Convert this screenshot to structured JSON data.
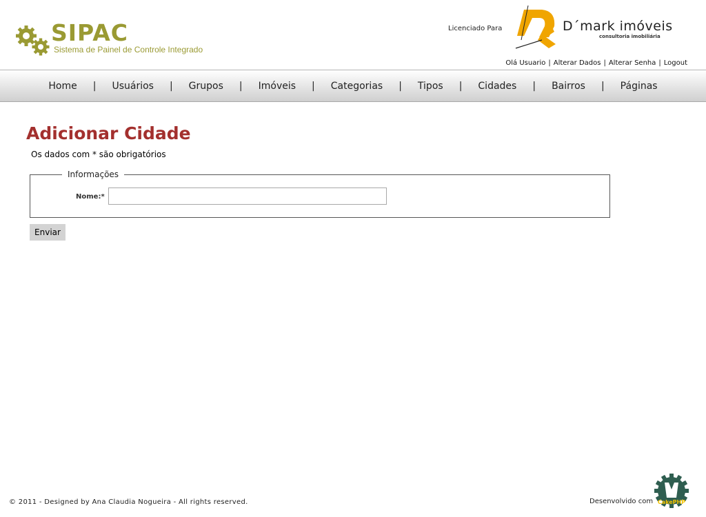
{
  "header": {
    "logo_title": "SIPAC",
    "logo_subtitle": "Sistema de Painel de Controle Integrado",
    "licensed_label": "Licenciado Para",
    "client_name": "D´mark imóveis",
    "client_tagline": "consultoria imobiliária",
    "user_links": {
      "greeting": "Olá Usuario",
      "edit_data": "Alterar Dados",
      "change_password": "Alterar Senha",
      "logout": "Logout",
      "separator": "|"
    }
  },
  "nav": {
    "items": [
      "Home",
      "Usuários",
      "Grupos",
      "Imóveis",
      "Categorias",
      "Tipos",
      "Cidades",
      "Bairros",
      "Páginas"
    ],
    "separator": "|"
  },
  "main": {
    "title": "Adicionar Cidade",
    "required_note": "Os dados com * são obrigatórios",
    "fieldset_legend": "Informações",
    "name_label": "Nome:*",
    "name_value": "",
    "submit_label": "Enviar"
  },
  "footer": {
    "copyright": "© 2011 - Designed by Ana Claudia Nogueira - All rights reserved.",
    "developed_with": "Desenvolvido com",
    "badge_text": "CakePHP"
  },
  "colors": {
    "logo_olive": "#9a9a33",
    "title_red": "#a3302e",
    "client_orange": "#f0a500",
    "cake_green": "#2f5e50"
  },
  "icons": {
    "logo": "gears-icon",
    "client": "dk-logo-icon",
    "badge": "cakephp-badge-icon"
  }
}
